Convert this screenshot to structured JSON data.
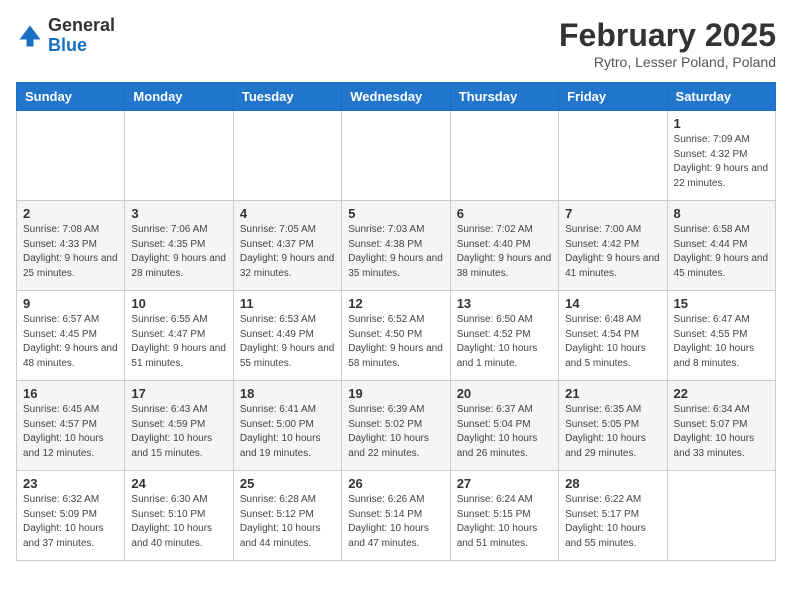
{
  "header": {
    "logo_line1": "General",
    "logo_line2": "Blue",
    "month_title": "February 2025",
    "location": "Rytro, Lesser Poland, Poland"
  },
  "weekdays": [
    "Sunday",
    "Monday",
    "Tuesday",
    "Wednesday",
    "Thursday",
    "Friday",
    "Saturday"
  ],
  "weeks": [
    [
      {
        "day": "",
        "info": ""
      },
      {
        "day": "",
        "info": ""
      },
      {
        "day": "",
        "info": ""
      },
      {
        "day": "",
        "info": ""
      },
      {
        "day": "",
        "info": ""
      },
      {
        "day": "",
        "info": ""
      },
      {
        "day": "1",
        "info": "Sunrise: 7:09 AM\nSunset: 4:32 PM\nDaylight: 9 hours and 22 minutes."
      }
    ],
    [
      {
        "day": "2",
        "info": "Sunrise: 7:08 AM\nSunset: 4:33 PM\nDaylight: 9 hours and 25 minutes."
      },
      {
        "day": "3",
        "info": "Sunrise: 7:06 AM\nSunset: 4:35 PM\nDaylight: 9 hours and 28 minutes."
      },
      {
        "day": "4",
        "info": "Sunrise: 7:05 AM\nSunset: 4:37 PM\nDaylight: 9 hours and 32 minutes."
      },
      {
        "day": "5",
        "info": "Sunrise: 7:03 AM\nSunset: 4:38 PM\nDaylight: 9 hours and 35 minutes."
      },
      {
        "day": "6",
        "info": "Sunrise: 7:02 AM\nSunset: 4:40 PM\nDaylight: 9 hours and 38 minutes."
      },
      {
        "day": "7",
        "info": "Sunrise: 7:00 AM\nSunset: 4:42 PM\nDaylight: 9 hours and 41 minutes."
      },
      {
        "day": "8",
        "info": "Sunrise: 6:58 AM\nSunset: 4:44 PM\nDaylight: 9 hours and 45 minutes."
      }
    ],
    [
      {
        "day": "9",
        "info": "Sunrise: 6:57 AM\nSunset: 4:45 PM\nDaylight: 9 hours and 48 minutes."
      },
      {
        "day": "10",
        "info": "Sunrise: 6:55 AM\nSunset: 4:47 PM\nDaylight: 9 hours and 51 minutes."
      },
      {
        "day": "11",
        "info": "Sunrise: 6:53 AM\nSunset: 4:49 PM\nDaylight: 9 hours and 55 minutes."
      },
      {
        "day": "12",
        "info": "Sunrise: 6:52 AM\nSunset: 4:50 PM\nDaylight: 9 hours and 58 minutes."
      },
      {
        "day": "13",
        "info": "Sunrise: 6:50 AM\nSunset: 4:52 PM\nDaylight: 10 hours and 1 minute."
      },
      {
        "day": "14",
        "info": "Sunrise: 6:48 AM\nSunset: 4:54 PM\nDaylight: 10 hours and 5 minutes."
      },
      {
        "day": "15",
        "info": "Sunrise: 6:47 AM\nSunset: 4:55 PM\nDaylight: 10 hours and 8 minutes."
      }
    ],
    [
      {
        "day": "16",
        "info": "Sunrise: 6:45 AM\nSunset: 4:57 PM\nDaylight: 10 hours and 12 minutes."
      },
      {
        "day": "17",
        "info": "Sunrise: 6:43 AM\nSunset: 4:59 PM\nDaylight: 10 hours and 15 minutes."
      },
      {
        "day": "18",
        "info": "Sunrise: 6:41 AM\nSunset: 5:00 PM\nDaylight: 10 hours and 19 minutes."
      },
      {
        "day": "19",
        "info": "Sunrise: 6:39 AM\nSunset: 5:02 PM\nDaylight: 10 hours and 22 minutes."
      },
      {
        "day": "20",
        "info": "Sunrise: 6:37 AM\nSunset: 5:04 PM\nDaylight: 10 hours and 26 minutes."
      },
      {
        "day": "21",
        "info": "Sunrise: 6:35 AM\nSunset: 5:05 PM\nDaylight: 10 hours and 29 minutes."
      },
      {
        "day": "22",
        "info": "Sunrise: 6:34 AM\nSunset: 5:07 PM\nDaylight: 10 hours and 33 minutes."
      }
    ],
    [
      {
        "day": "23",
        "info": "Sunrise: 6:32 AM\nSunset: 5:09 PM\nDaylight: 10 hours and 37 minutes."
      },
      {
        "day": "24",
        "info": "Sunrise: 6:30 AM\nSunset: 5:10 PM\nDaylight: 10 hours and 40 minutes."
      },
      {
        "day": "25",
        "info": "Sunrise: 6:28 AM\nSunset: 5:12 PM\nDaylight: 10 hours and 44 minutes."
      },
      {
        "day": "26",
        "info": "Sunrise: 6:26 AM\nSunset: 5:14 PM\nDaylight: 10 hours and 47 minutes."
      },
      {
        "day": "27",
        "info": "Sunrise: 6:24 AM\nSunset: 5:15 PM\nDaylight: 10 hours and 51 minutes."
      },
      {
        "day": "28",
        "info": "Sunrise: 6:22 AM\nSunset: 5:17 PM\nDaylight: 10 hours and 55 minutes."
      },
      {
        "day": "",
        "info": ""
      }
    ]
  ]
}
